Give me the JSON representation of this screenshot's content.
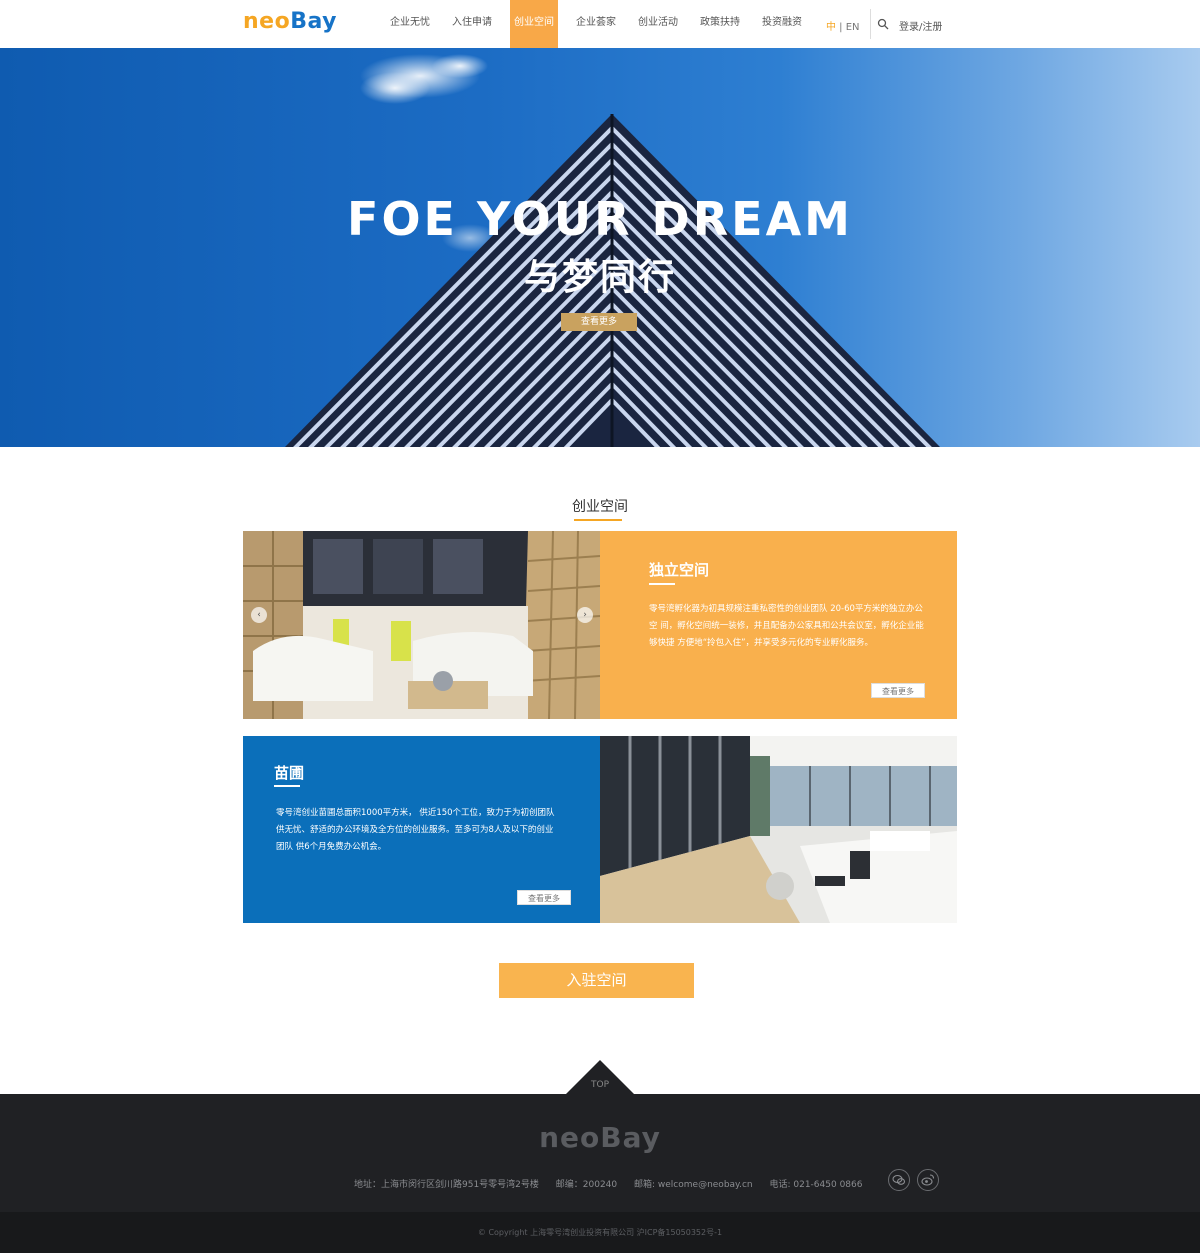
{
  "header": {
    "logo_neo": "neo",
    "logo_bay": "Bay",
    "nav": [
      "企业无忧",
      "入住申请",
      "创业空间",
      "企业荟家",
      "创业活动",
      "政策扶持",
      "投资融资"
    ],
    "active_index": 2,
    "lang_zh": "中",
    "lang_sep": " | ",
    "lang_en": "EN",
    "login": "登录/注册",
    "search_icon": "search-icon"
  },
  "hero": {
    "title": "FOE YOUR DREAM",
    "subtitle": "与梦同行",
    "button": "查看更多"
  },
  "section": {
    "title": "创业空间"
  },
  "cards": [
    {
      "title": "独立空间",
      "text": "零号湾孵化器为初具规模注重私密性的创业团队 20-60平方米的独立办公空 间，孵化空间统一装修，并且配备办公家具和公共会议室，孵化企业能够快捷 方便地“拎包入住”，并享受多元化的专业孵化服务。",
      "button": "查看更多",
      "color": "#f9b04d"
    },
    {
      "title": "苗圃",
      "text": "零号湾创业苗圃总面积1000平方米， 供近150个工位，致力于为初创团队供无忧、舒适的办公环境及全方位的创业服务。至多可为8人及以下的创业团队 供6个月免费办公机会。",
      "button": "查看更多",
      "color": "#0b6fba"
    }
  ],
  "join_button": "入驻空间",
  "footer": {
    "top_label": "TOP",
    "logo": "neoBay",
    "address": "地址：上海市闵行区剑川路951号零号湾2号楼",
    "postcode": "邮编：200240",
    "email": "邮箱: welcome@neobay.cn",
    "phone": "电话: 021-6450 0866",
    "social_wechat": "wechat-icon",
    "social_weibo": "weibo-icon",
    "copyright": "© Copyright 上海零号湾创业投资有限公司 沪ICP备15050352号-1"
  }
}
